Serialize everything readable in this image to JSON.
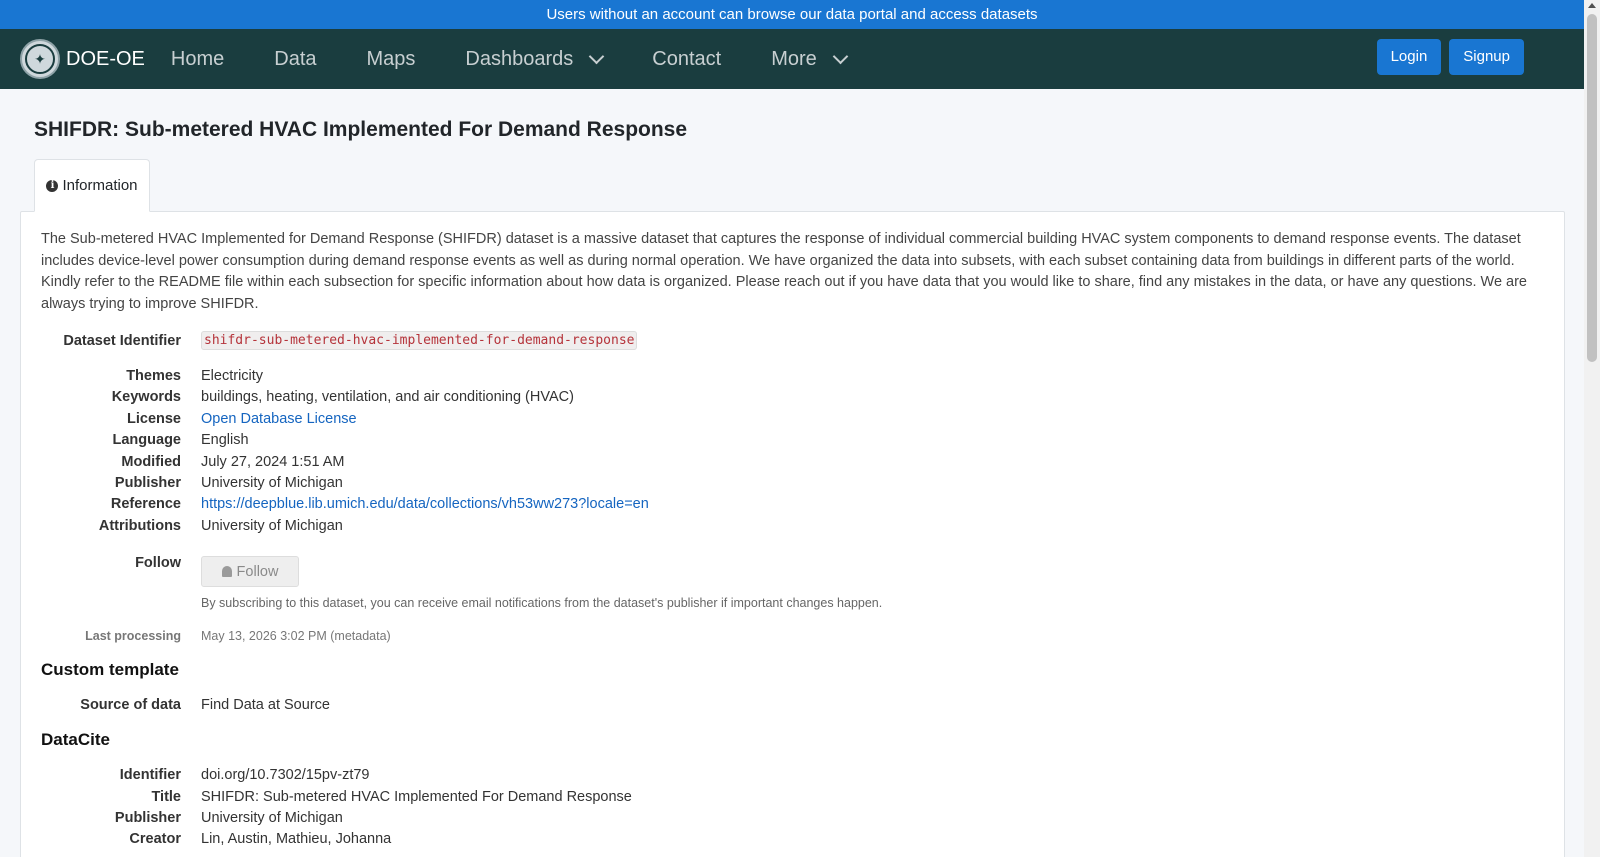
{
  "banner": {
    "text": "Users without an account can browse our data portal and access datasets"
  },
  "navbar": {
    "brand": "DOE-OE",
    "items": [
      {
        "label": "Home"
      },
      {
        "label": "Data"
      },
      {
        "label": "Maps"
      },
      {
        "label": "Dashboards"
      },
      {
        "label": "Contact"
      },
      {
        "label": "More"
      }
    ],
    "login_label": "Login",
    "signup_label": "Signup"
  },
  "page": {
    "title": "SHIFDR: Sub-metered HVAC Implemented For Demand Response"
  },
  "tabs": [
    {
      "label": "Information"
    }
  ],
  "info": {
    "description": "The Sub-metered HVAC Implemented for Demand Response (SHIFDR) dataset is a massive dataset that captures the response of individual commercial building HVAC system components to demand response events. The dataset includes device-level power consumption during demand response events as well as during normal operation. We have organized the data into subsets, with each subset containing data from buildings in different parts of the world. Kindly refer to the README file within each subsection for specific information about how data is organized. Please reach out if you have data that you would like to share, find any mistakes in the data, or have any questions. We are always trying to improve SHIFDR.",
    "identifier_label": "Dataset Identifier",
    "identifier": "shifdr-sub-metered-hvac-implemented-for-demand-response",
    "fields": [
      {
        "label": "Themes",
        "value": "Electricity"
      },
      {
        "label": "Keywords",
        "value": "buildings, heating, ventilation, and air conditioning (HVAC)"
      },
      {
        "label": "License",
        "value": "Open Database License"
      },
      {
        "label": "Language",
        "value": "English"
      },
      {
        "label": "Modified",
        "value": "July 27, 2024 1:51 AM"
      },
      {
        "label": "Publisher",
        "value": "University of Michigan"
      },
      {
        "label": "Reference",
        "value": "https://deepblue.lib.umich.edu/data/collections/vh53ww273?locale=en"
      },
      {
        "label": "Attributions",
        "value": "University of Michigan"
      }
    ],
    "follow_label": "Follow",
    "follow_button": "Follow",
    "follow_note": "By subscribing to this dataset, you can receive email notifications from the dataset's publisher if important changes happen.",
    "last_processing_label": "Last processing",
    "last_processing_value": "May 13, 2026 3:02 PM (metadata)"
  },
  "custom_template": {
    "heading": "Custom template",
    "source_label": "Source of data",
    "source_value": "Find Data at Source"
  },
  "datacite": {
    "heading": "DataCite",
    "fields": [
      {
        "label": "Identifier",
        "value": "doi.org/10.7302/15pv-zt79"
      },
      {
        "label": "Title",
        "value": "SHIFDR: Sub-metered HVAC Implemented For Demand Response"
      },
      {
        "label": "Publisher",
        "value": "University of Michigan"
      },
      {
        "label": "Creator",
        "value": "Lin, Austin, Mathieu, Johanna"
      }
    ]
  },
  "colors": {
    "banner": "#1976d2",
    "navbar": "#1a3d3f",
    "link": "#1565c0",
    "button": "#1976d2"
  }
}
